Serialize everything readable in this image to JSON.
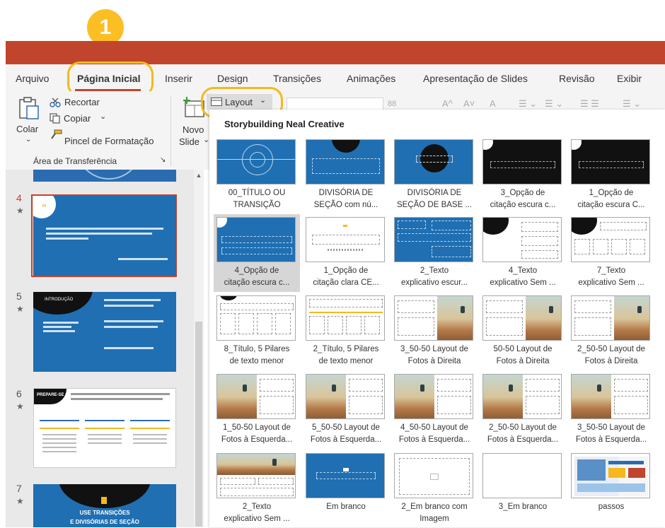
{
  "callout": {
    "number": "1"
  },
  "tabs": [
    "Arquivo",
    "Página Inicial",
    "Inserir",
    "Design",
    "Transições",
    "Animações",
    "Apresentação de Slides",
    "Revisão",
    "Exibir"
  ],
  "ribbon": {
    "colar": "Colar",
    "recortar": "Recortar",
    "copiar": "Copiar",
    "pincel": "Pincel de Formatação",
    "group_label": "Área de Transferência",
    "novo": "Novo",
    "slide": "Slide",
    "layout": "Layout",
    "font_size": "88"
  },
  "gallery": {
    "heading": "Storybuilding Neal Creative",
    "items": [
      {
        "line1": "00_TÍTULO OU",
        "line2": "TRANSIÇÃO"
      },
      {
        "line1": "DIVISÓRIA DE",
        "line2": "SEÇÃO com nú..."
      },
      {
        "line1": "DIVISÓRIA DE",
        "line2": "SEÇÃO DE BASE ..."
      },
      {
        "line1": "3_Opção de",
        "line2": "citação escura c..."
      },
      {
        "line1": "1_Opção de",
        "line2": "citação escura C..."
      },
      {
        "line1": "4_Opção de",
        "line2": "citação escura c..."
      },
      {
        "line1": "1_Opção de",
        "line2": "citação clara CE..."
      },
      {
        "line1": "2_Texto",
        "line2": "explicativo escur..."
      },
      {
        "line1": "4_Texto",
        "line2": "explicativo Sem ..."
      },
      {
        "line1": "7_Texto",
        "line2": "explicativo Sem ..."
      },
      {
        "line1": "8_Título, 5 Pilares",
        "line2": "de texto menor"
      },
      {
        "line1": "2_Título, 5 Pilares",
        "line2": "de texto menor"
      },
      {
        "line1": "3_50-50 Layout de",
        "line2": "Fotos à Direita"
      },
      {
        "line1": "50-50 Layout de",
        "line2": "Fotos à Direita"
      },
      {
        "line1": "2_50-50 Layout de",
        "line2": "Fotos à Direita"
      },
      {
        "line1": "1_50-50 Layout de",
        "line2": "Fotos à Esquerda..."
      },
      {
        "line1": "5_50-50 Layout de",
        "line2": "Fotos à Esquerda..."
      },
      {
        "line1": "4_50-50 Layout de",
        "line2": "Fotos à Esquerda..."
      },
      {
        "line1": "2_50-50 Layout de",
        "line2": "Fotos à Esquerda..."
      },
      {
        "line1": "3_50-50 Layout de",
        "line2": "Fotos à Esquerda..."
      },
      {
        "line1": "2_Texto",
        "line2": "explicativo Sem ..."
      },
      {
        "line1": "Em branco",
        "line2": ""
      },
      {
        "line1": "2_Em branco com",
        "line2": "Imagem"
      },
      {
        "line1": "3_Em branco",
        "line2": ""
      },
      {
        "line1": "passos",
        "line2": ""
      }
    ]
  },
  "thumbnails": [
    {
      "number": "4",
      "star": "★"
    },
    {
      "number": "5",
      "star": "★",
      "title": "INTRODUÇÃO"
    },
    {
      "number": "6",
      "star": "★",
      "title": "PREPARE-SE"
    },
    {
      "number": "7",
      "star": "★",
      "title1": "USE TRANSIÇÕES",
      "title2": "E DIVISÓRIAS DE SEÇÃO"
    }
  ]
}
